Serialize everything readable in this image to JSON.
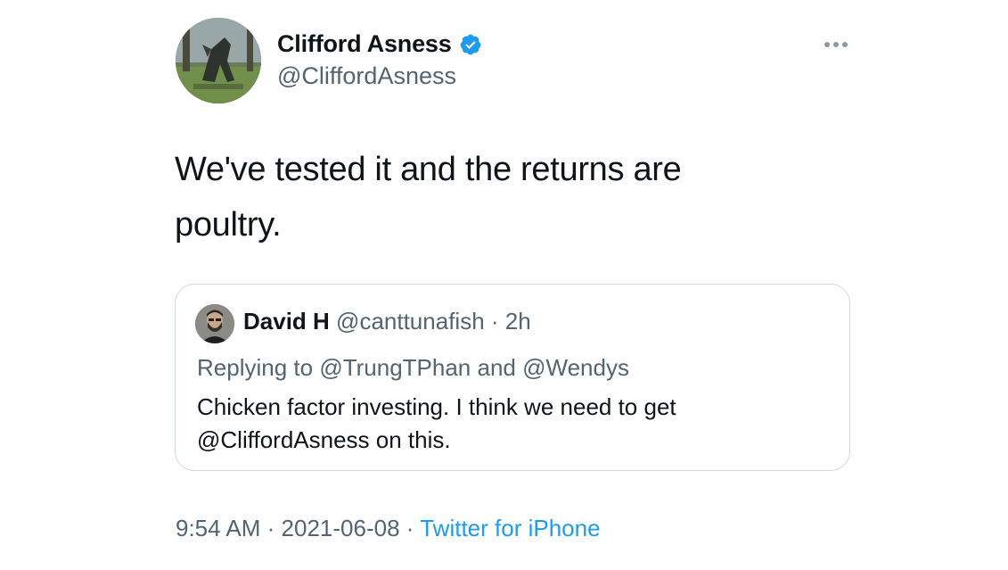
{
  "author": {
    "display_name": "Clifford Asness",
    "handle": "@CliffordAsness",
    "verified": true,
    "avatar_icon": "avatar-sculpture-photo"
  },
  "tweet": {
    "text_line1": "We've tested it and the returns are",
    "text_line2": "poultry."
  },
  "quote": {
    "name": "David H",
    "handle": "@canttunafish",
    "separator": "·",
    "time": "2h",
    "replying_prefix": "Replying to",
    "replying_user1": "@TrungTPhan",
    "replying_and": "and",
    "replying_user2": "@Wendys",
    "text_line1": "Chicken factor investing. I think we need to get",
    "text_line2": "@CliffordAsness on this."
  },
  "meta": {
    "time": "9:54 AM",
    "separator": "·",
    "date": "2021-06-08",
    "source": "Twitter for iPhone"
  },
  "colors": {
    "text": "#0f1419",
    "secondary": "#536471",
    "link": "#1d9bf0",
    "border": "#cfd9de",
    "verified": "#1d9bf0"
  }
}
